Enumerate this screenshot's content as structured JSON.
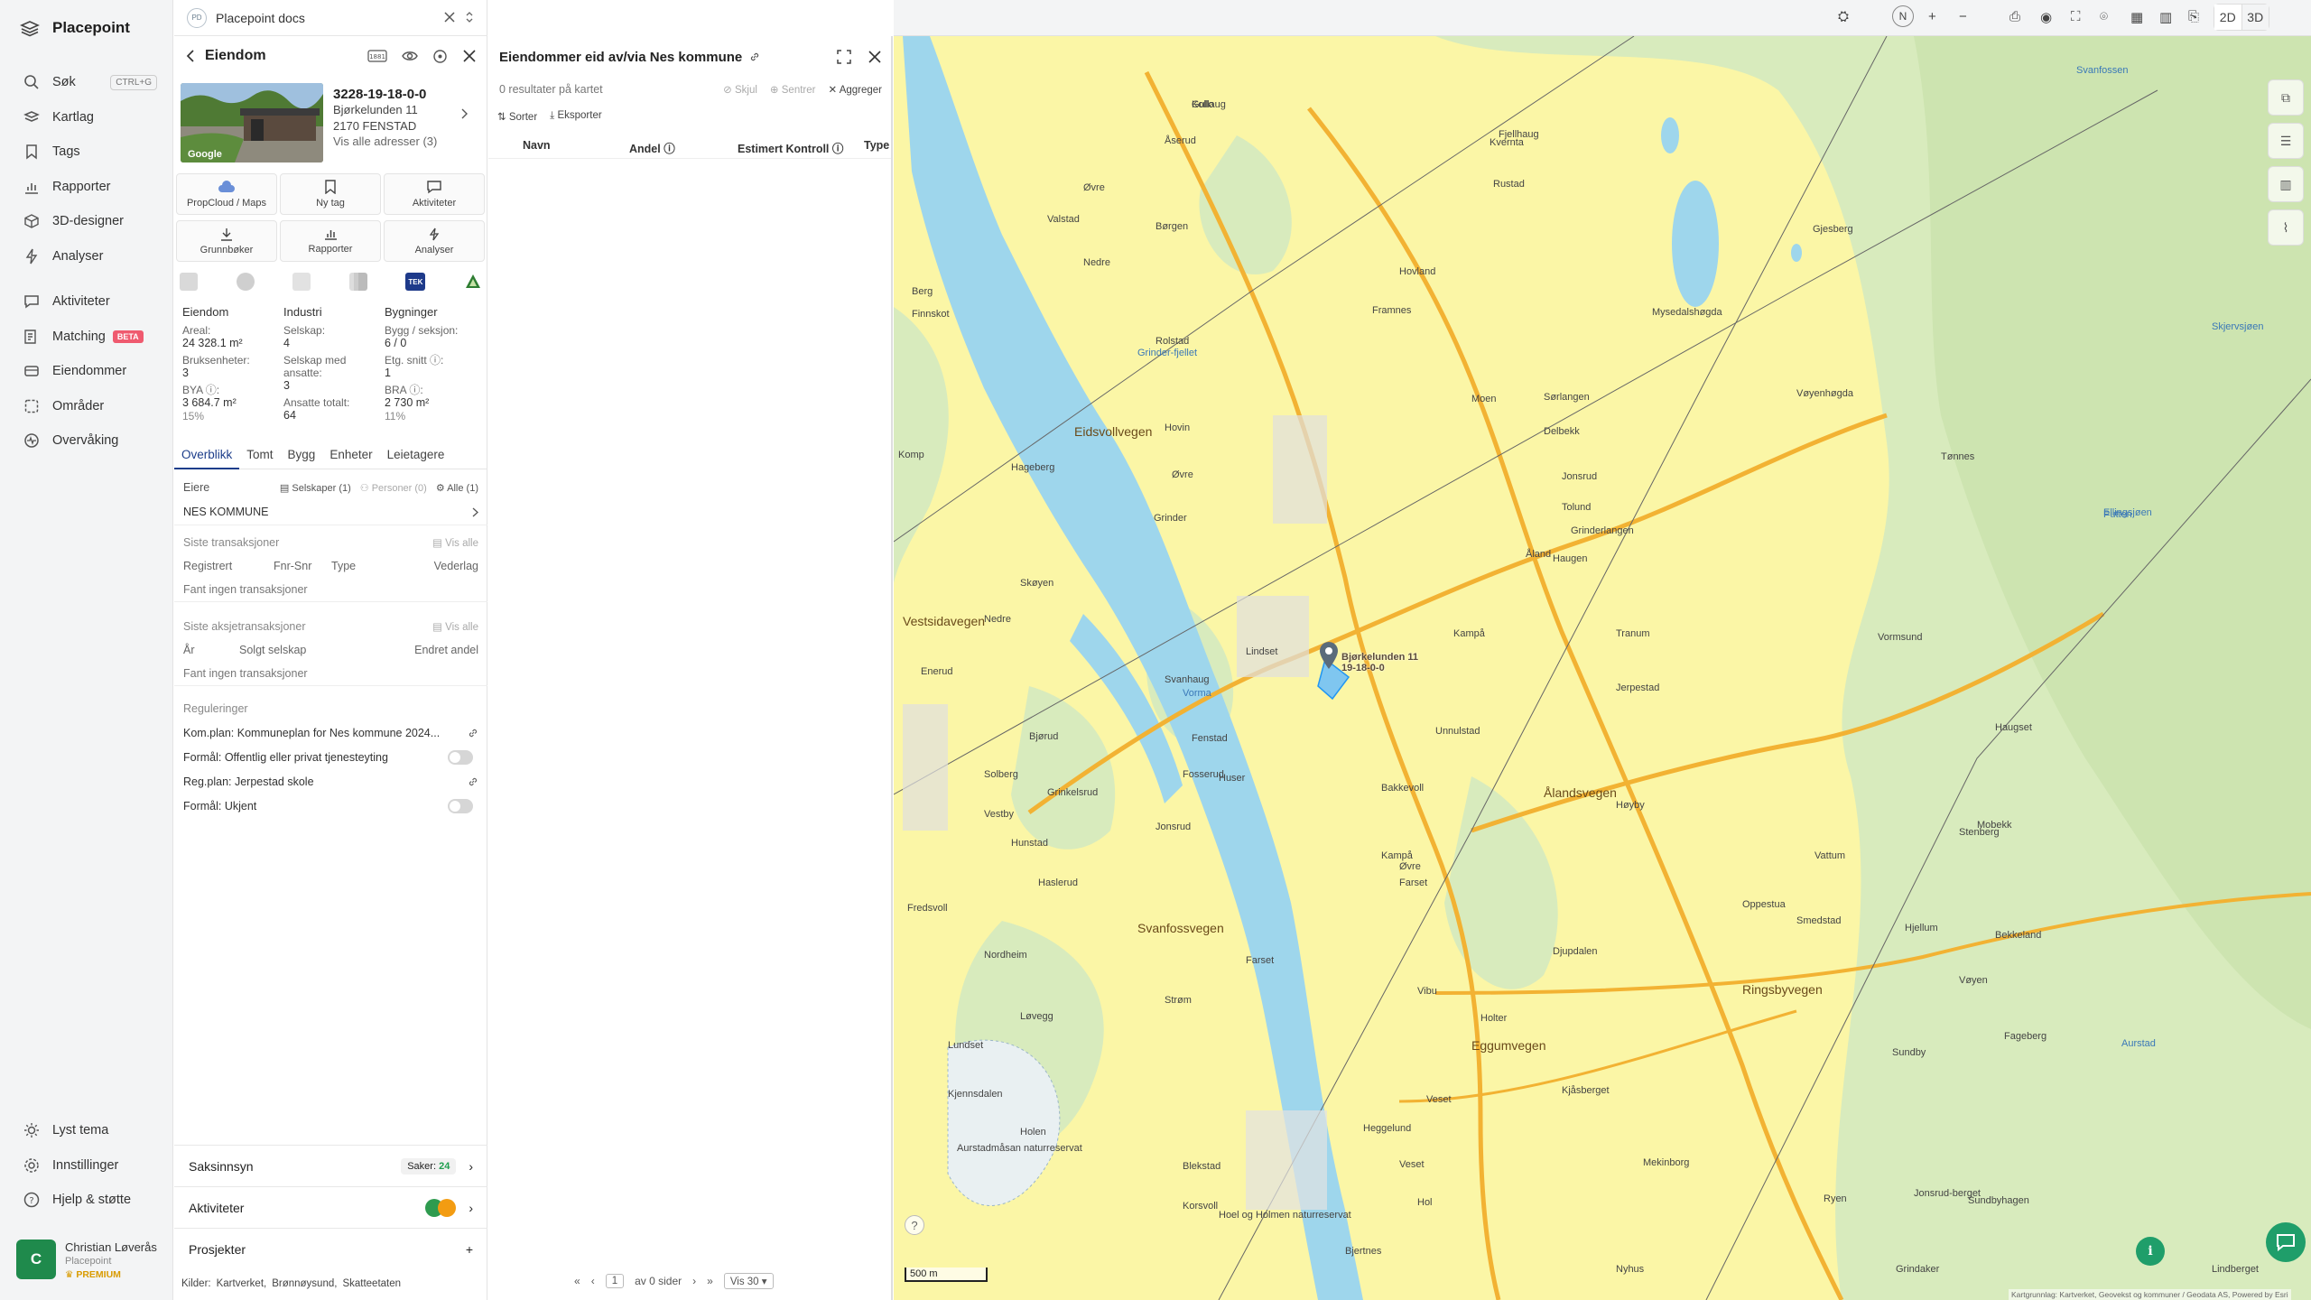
{
  "app": {
    "name": "Placepoint"
  },
  "nav": {
    "items": [
      {
        "icon": "search-icon",
        "label": "Søk",
        "kbd": "CTRL+G"
      },
      {
        "icon": "layers-icon",
        "label": "Kartlag"
      },
      {
        "icon": "bookmark-icon",
        "label": "Tags"
      },
      {
        "icon": "bar-chart-icon",
        "label": "Rapporter"
      },
      {
        "icon": "cube-icon",
        "label": "3D-designer"
      },
      {
        "icon": "bolt-icon",
        "label": "Analyser"
      }
    ],
    "items2": [
      {
        "icon": "chat-icon",
        "label": "Aktiviteter"
      },
      {
        "icon": "puzzle-icon",
        "label": "Matching",
        "badge": "BETA"
      },
      {
        "icon": "building-icon",
        "label": "Eiendommer"
      },
      {
        "icon": "area-icon",
        "label": "Områder"
      },
      {
        "icon": "pulse-icon",
        "label": "Overvåking"
      }
    ],
    "bottom": [
      {
        "icon": "sun-icon",
        "label": "Lyst tema"
      },
      {
        "icon": "gear-icon",
        "label": "Innstillinger"
      },
      {
        "icon": "help-icon",
        "label": "Hjelp & støtte"
      }
    ],
    "user": {
      "initial": "C",
      "name": "Christian Løverås",
      "org": "Placepoint",
      "plan": "PREMIUM"
    }
  },
  "doc_tab": {
    "logo": "PD",
    "title": "Placepoint docs"
  },
  "property": {
    "header": "Eiendom",
    "gnr": "3228-19-18-0-0",
    "street": "Bjørkelunden 11",
    "postal": "2170 FENSTAD",
    "all_addresses": "Vis alle adresser (3)",
    "photo_credit": "Google",
    "actions": [
      {
        "icon": "cloud-icon",
        "label": "PropCloud / Maps"
      },
      {
        "icon": "bookmark-icon",
        "label": "Ny tag"
      },
      {
        "icon": "chat-icon",
        "label": "Aktiviteter"
      },
      {
        "icon": "download-icon",
        "label": "Grunnbøker"
      },
      {
        "icon": "bar-chart-icon",
        "label": "Rapporter"
      },
      {
        "icon": "bolt-icon",
        "label": "Analyser"
      }
    ],
    "source_tek": "TEK",
    "stats": {
      "eiendom": {
        "head": "Eiendom",
        "areal_k": "Areal:",
        "areal_v": "24 328.1 m²",
        "bruks_k": "Bruksenheter:",
        "bruks_v": "3",
        "bya_k": "BYA ⓘ:",
        "bya_v": "3 684.7 m²",
        "bya_p": "15%"
      },
      "industri": {
        "head": "Industri",
        "selskap_k": "Selskap:",
        "selskap_v": "4",
        "ansatte_k": "Selskap med ansatte:",
        "ansatte_v": "3",
        "tot_k": "Ansatte totalt:",
        "tot_v": "64"
      },
      "bygninger": {
        "head": "Bygninger",
        "bygg_k": "Bygg / seksjon:",
        "bygg_v": "6 / 0",
        "etg_k": "Etg. snitt ⓘ:",
        "etg_v": "1",
        "bra_k": "BRA ⓘ:",
        "bra_v": "2 730 m²",
        "bra_p": "11%"
      }
    },
    "subtabs": [
      "Overblikk",
      "Tomt",
      "Bygg",
      "Enheter",
      "Leietagere"
    ],
    "owners": {
      "label": "Eiere",
      "selskaper": "Selskaper (1)",
      "personer": "Personer (0)",
      "alle": "Alle (1)",
      "owner": "NES KOMMUNE"
    },
    "transactions": {
      "label": "Siste transaksjoner",
      "vis_alle": "Vis alle",
      "cols": [
        "Registrert",
        "Fnr-Snr",
        "Type",
        "Vederlag"
      ],
      "empty": "Fant ingen transaksjoner"
    },
    "share_tx": {
      "label": "Siste aksjetransaksjoner",
      "vis_alle": "Vis alle",
      "cols": [
        "År",
        "Solgt selskap",
        "Endret andel"
      ],
      "empty": "Fant ingen transaksjoner"
    },
    "regulations": {
      "label": "Reguleringer",
      "kom_plan": "Kom.plan: Kommuneplan for Nes kommune 2024...",
      "formal1": "Formål: Offentlig eller privat tjenesteyting",
      "reg_plan": "Reg.plan: Jerpestad skole",
      "formal2": "Formål: Ukjent"
    },
    "footer": {
      "saksinnsyn": "Saksinnsyn",
      "saker_k": "Saker:",
      "saker_v": "24",
      "aktiviteter": "Aktiviteter",
      "prosjekter": "Prosjekter"
    },
    "sources_line": "Kilder:",
    "sources": [
      "Kartverket,",
      "Brønnøysund,",
      "Skatteetaten"
    ]
  },
  "results": {
    "title": "Eiendommer eid av/via Nes kommune",
    "count": "0 resultater på kartet",
    "skjul": "Skjul",
    "sentrer": "Sentrer",
    "aggreger": "Aggreger",
    "sorter": "Sorter",
    "eksporter": "Eksporter",
    "columns": [
      "Navn",
      "Andel ⓘ",
      "Estimert Kontroll ⓘ",
      "Type"
    ],
    "pager": {
      "page": "1",
      "of_pages": "av 0 sider",
      "per_page": "Vis 30"
    }
  },
  "map": {
    "mode_2d": "2D",
    "mode_3d": "3D",
    "compass": "N",
    "scale": "500 m",
    "credit": "Kartgrunnlag: Kartverket, Geovekst og kommuner / Geodata AS, Powered by Esri",
    "marker_label": "Bjørkelunden 11",
    "marker_sub": "19-18-0-0",
    "place_labels": [
      "Gullaug",
      "Åserud",
      "Øvre",
      "Valstad",
      "Nedre",
      "Berg",
      "Finnskot",
      "Hageberg",
      "Komp",
      "Skøyen",
      "Nedre",
      "Enerud",
      "Bjørud",
      "Solberg",
      "Vestby",
      "Fredsvoll",
      "Nordheim",
      "Lundset",
      "Kjennsdalen",
      "Børgen",
      "Rolstad",
      "Hovin",
      "Øvre",
      "Grinder",
      "Svanhaug",
      "Lindset",
      "Fenstad",
      "Huser",
      "Fosserud",
      "Grinkelsrud",
      "Jonsrud",
      "Hunstad",
      "Haslerud",
      "Løvegg",
      "Strøm",
      "Farset",
      "Holen",
      "Blekstad",
      "Korsvoll",
      "Kampå",
      "Haugen",
      "Åland",
      "Jerpestad",
      "Unnulstad",
      "Bakkevoll",
      "Tranum",
      "Hovland",
      "Framnes",
      "Moen",
      "Rustad",
      "Kvernta",
      "Fjellhaug",
      "Sørlangen",
      "Delbekk",
      "Jonsrud",
      "Tolund",
      "Grinderlangen",
      "Hø­yby",
      "Kampå",
      "Øvre",
      "Farset",
      "Djupdalen",
      "Vibu",
      "Holter",
      "Veset",
      "Kjåsberget",
      "Mekinborg",
      "Veset",
      "Nyhus",
      "Hol",
      "Sundbyhagen",
      "Ryen",
      "Bekkeland",
      "Stenberg",
      "Mobekk",
      "Smedstad",
      "Oppestua",
      "Vattum",
      "Hjellum",
      "Vøyen",
      "Fageberg",
      "Sundby",
      "Grindaker",
      "Jonsrud-berget",
      "Lindberget",
      "Mysedalshøgda",
      "Vøyenhøgda",
      "Putten",
      "Ellingsjøen",
      "Skjervsjøen",
      "Gjesberg",
      "Svanfossen",
      "Vormsund",
      "Vorma",
      "Svanfossvegen",
      "Eidsvollvegen",
      "Ålandsvegen",
      "Eggumvegen",
      "Ringsbyvegen",
      "Aurstad",
      "Aurstadmåsan naturreservat",
      "Vestsidavegen",
      "Grinder-fjellet",
      "Heggelund",
      "Hoel og Holmen naturreservat",
      "Bjertnes",
      "Tønnes",
      "Haugset",
      "Kollo"
    ]
  }
}
